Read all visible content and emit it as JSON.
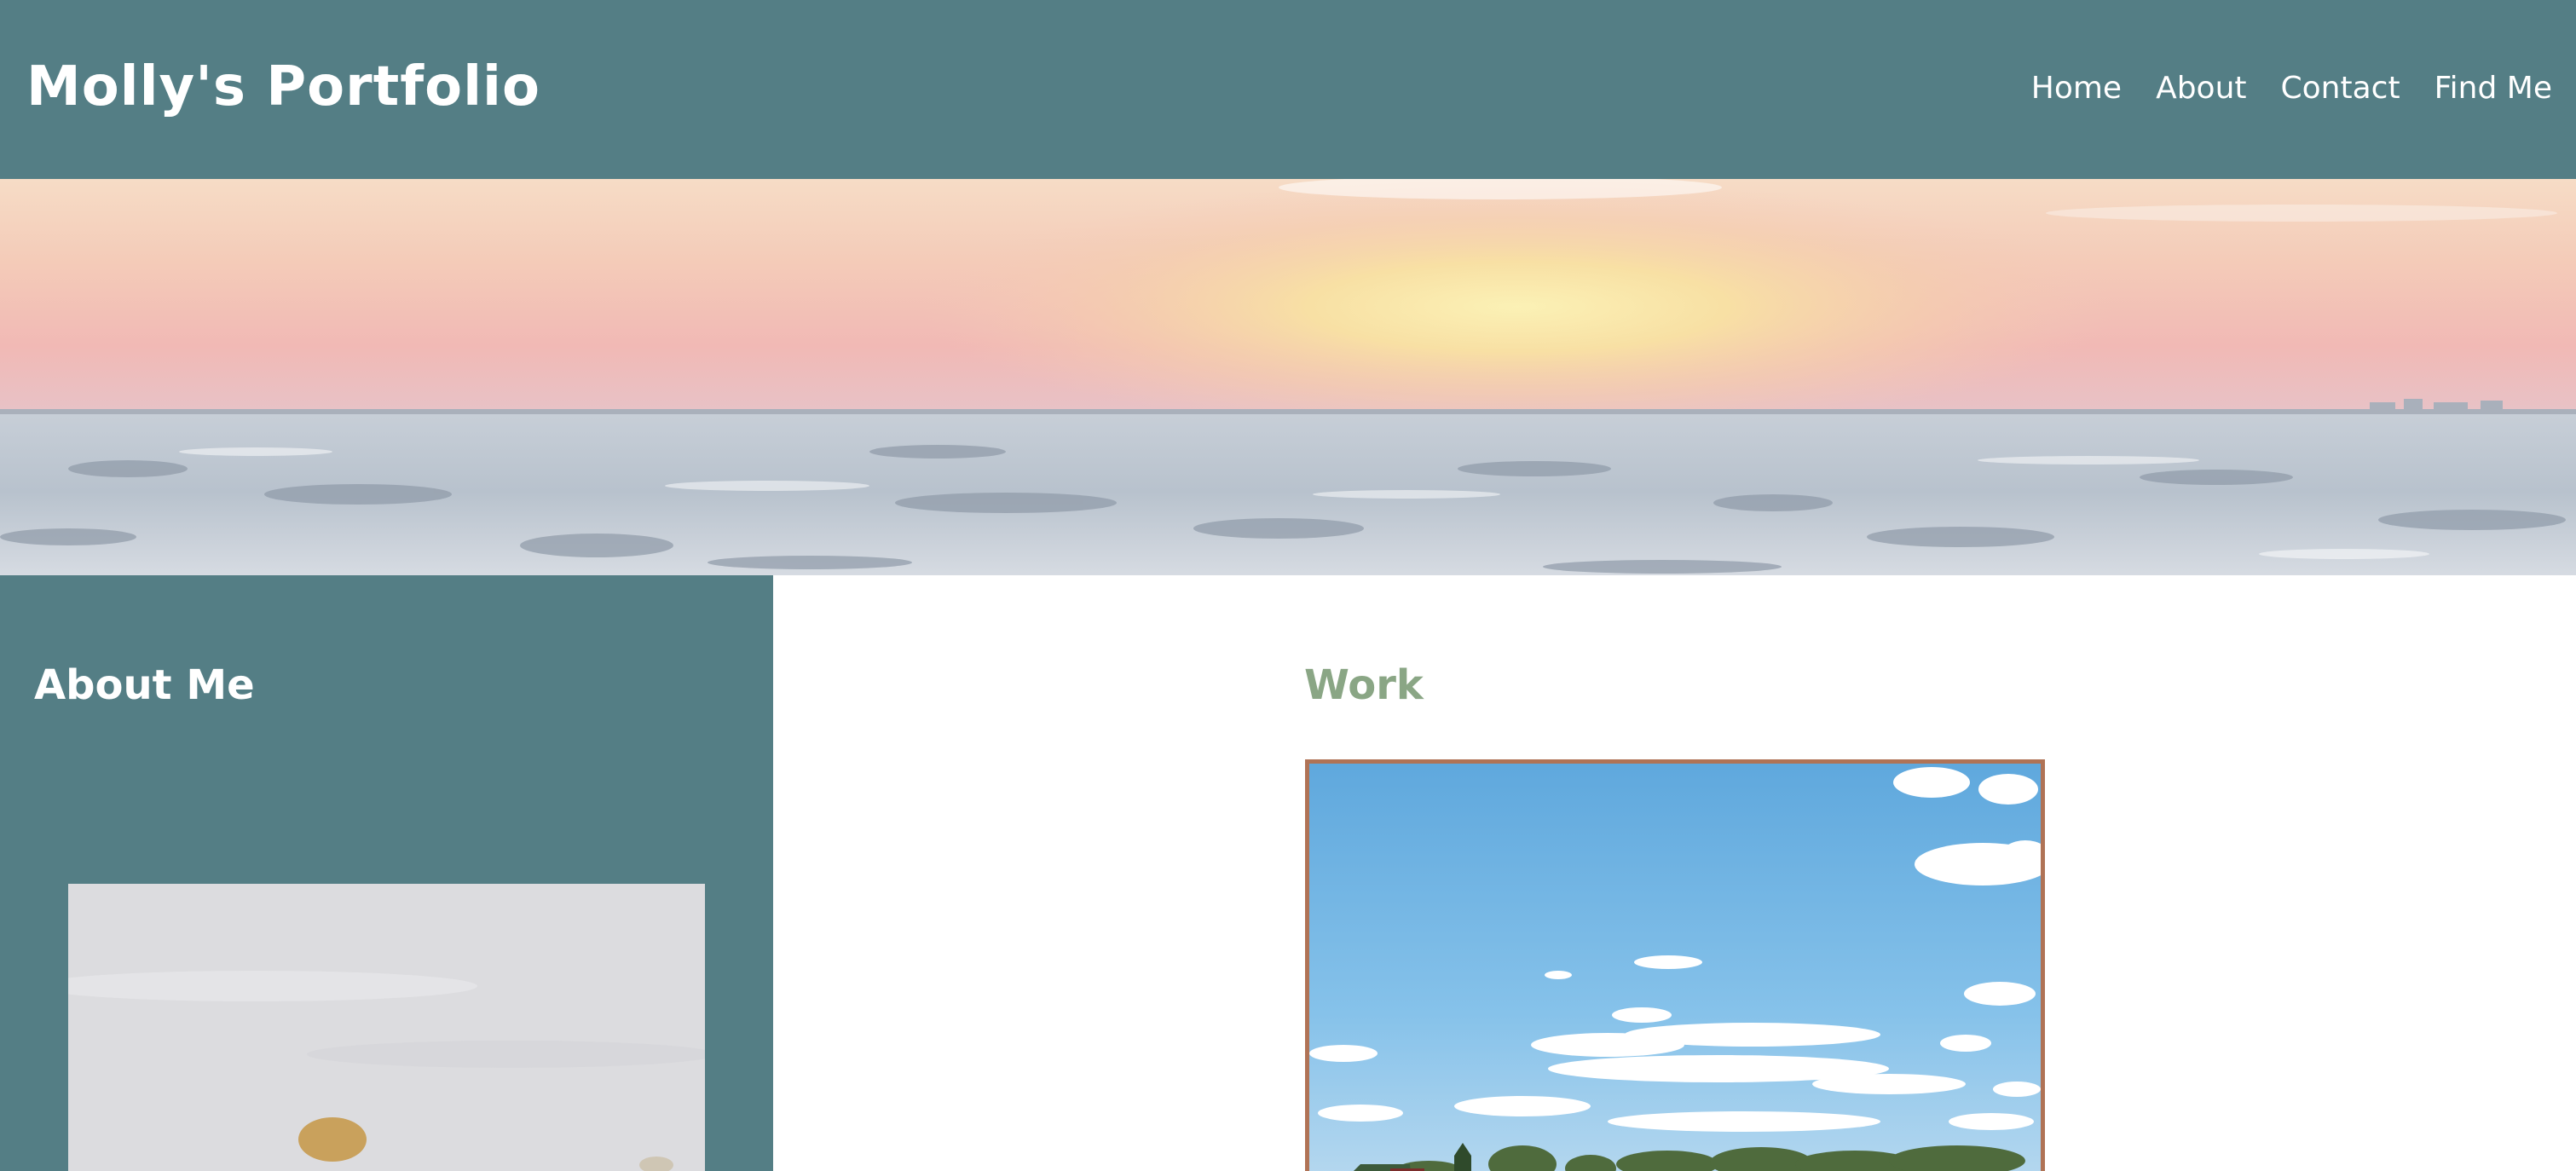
{
  "header": {
    "title": "Molly's Portfolio",
    "nav": [
      {
        "label": "Home"
      },
      {
        "label": "About"
      },
      {
        "label": "Contact"
      },
      {
        "label": "Find Me"
      }
    ]
  },
  "sidebar": {
    "heading": "About Me"
  },
  "main": {
    "heading": "Work"
  },
  "colors": {
    "header_bg": "#547e85",
    "sidebar_bg": "#547e85",
    "work_heading": "#8aa685",
    "photo_border": "#b07356",
    "text_light": "#ffffff"
  }
}
